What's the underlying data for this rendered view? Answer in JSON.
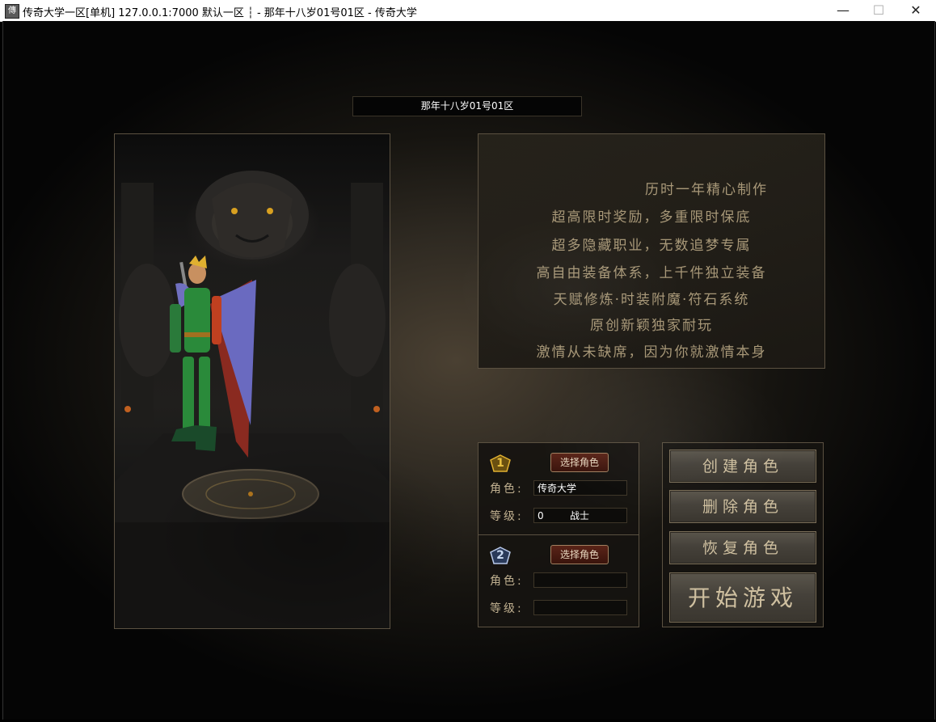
{
  "window": {
    "icon": "app-icon",
    "title": "传奇大学一区[单机] 127.0.0.1:7000  默认一区 ┆ - 那年十八岁01号01区 - 传奇大学",
    "minimize": "—",
    "maximize": "☐",
    "close": "✕"
  },
  "server": {
    "name": "那年十八岁01号01区"
  },
  "description": {
    "lines": [
      "历时一年精心制作",
      "超高限时奖励，多重限时保底",
      "超多隐藏职业，无数追梦专属",
      "高自由装备体系，上千件独立装备",
      "天赋修炼·时装附魔·符石系统",
      "原创新颖独家耐玩",
      "激情从未缺席，因为你就激情本身"
    ]
  },
  "slots": [
    {
      "number": "1",
      "select_label": "选择角色",
      "role_label": "角色:",
      "role_value": "传奇大学",
      "level_label": "等级:",
      "level_value": "0",
      "class_value": "战士"
    },
    {
      "number": "2",
      "select_label": "选择角色",
      "role_label": "角色:",
      "role_value": "",
      "level_label": "等级:",
      "level_value": "",
      "class_value": ""
    }
  ],
  "actions": {
    "create": "创建角色",
    "delete": "删除角色",
    "restore": "恢复角色",
    "start": "开始游戏"
  }
}
